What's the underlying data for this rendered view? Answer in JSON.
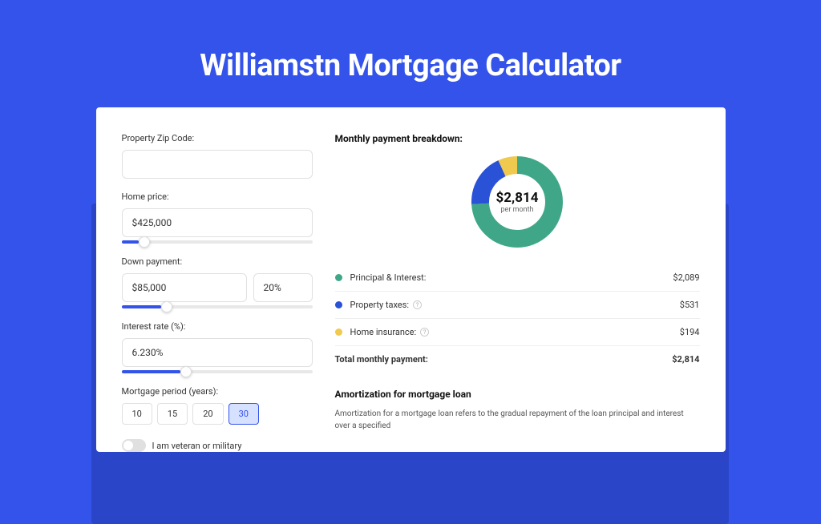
{
  "hero": {
    "title": "Williamstn Mortgage Calculator"
  },
  "form": {
    "zip": {
      "label": "Property Zip Code:",
      "value": ""
    },
    "price": {
      "label": "Home price:",
      "value": "$425,000",
      "slider_pct": 9
    },
    "down": {
      "label": "Down payment:",
      "value": "$85,000",
      "pct_value": "20%",
      "slider_pct": 21
    },
    "rate": {
      "label": "Interest rate (%):",
      "value": "6.230%",
      "slider_pct": 31
    },
    "period": {
      "label": "Mortgage period (years):",
      "options": [
        "10",
        "15",
        "20",
        "30"
      ],
      "active": "30"
    },
    "veteran": {
      "label": "I am veteran or military"
    }
  },
  "breakdown": {
    "title": "Monthly payment breakdown:",
    "center_value": "$2,814",
    "center_sub": "per month",
    "items": [
      {
        "label": "Principal & Interest:",
        "value": "$2,089",
        "color": "#3fa787",
        "help": false
      },
      {
        "label": "Property taxes:",
        "value": "$531",
        "color": "#2a52d6",
        "help": true
      },
      {
        "label": "Home insurance:",
        "value": "$194",
        "color": "#f0c94f",
        "help": true
      }
    ],
    "total": {
      "label": "Total monthly payment:",
      "value": "$2,814"
    }
  },
  "amort": {
    "title": "Amortization for mortgage loan",
    "text": "Amortization for a mortgage loan refers to the gradual repayment of the loan principal and interest over a specified"
  },
  "chart_data": {
    "type": "pie",
    "title": "Monthly payment breakdown",
    "series": [
      {
        "name": "Principal & Interest",
        "value": 2089,
        "color": "#3fa787"
      },
      {
        "name": "Property taxes",
        "value": 531,
        "color": "#2a52d6"
      },
      {
        "name": "Home insurance",
        "value": 194,
        "color": "#f0c94f"
      }
    ],
    "total": 2814
  }
}
